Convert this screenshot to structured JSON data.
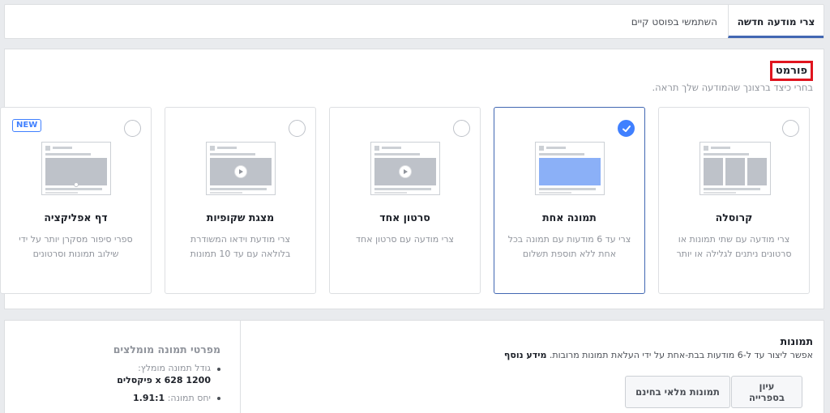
{
  "tabs": [
    {
      "label": "צרי מודעה חדשה",
      "active": true
    },
    {
      "label": "השתמשי בפוסט קיים",
      "active": false
    }
  ],
  "format": {
    "title": "פורמט",
    "description": "בחרי כיצד ברצונך שהמודעה שלך תראה.",
    "cards": [
      {
        "id": "carousel",
        "title": "קרוסלה",
        "description": "צרי מודעה עם שתי תמונות או סרטונים ניתנים לגלילה או יותר",
        "selected": false
      },
      {
        "id": "single-image",
        "title": "תמונה אחת",
        "description": "צרי עד 6 מודעות עם תמונה בכל אחת ללא תוספת תשלום",
        "selected": true
      },
      {
        "id": "single-video",
        "title": "סרטון אחד",
        "description": "צרי מודעה עם סרטון אחד",
        "selected": false
      },
      {
        "id": "slideshow",
        "title": "מצגת שקופיות",
        "description": "צרי מודעת וידאו המשודרת בלולאה עם עד 10 תמונות",
        "selected": false
      },
      {
        "id": "canvas",
        "title": "דף אפליקציה",
        "description": "ספרי סיפור מסקרן יותר על ידי שילוב תמונות וסרטונים",
        "selected": false,
        "badge": "NEW"
      }
    ]
  },
  "images": {
    "title": "תמונות",
    "description": "אפשר ליצור עד ל-6 מודעות בבת-אחת על ידי העלאת תמונות מרובות.",
    "learn_more": "מידע נוסף",
    "library_button": "עיון בספרייה",
    "stock_button": "תמונות מלאי בחינם"
  },
  "specs": {
    "title": "מפרטי תמונה מומלצים",
    "size_label": "גודל תמונה מומלץ:",
    "size_value": "1200 x 628 פיקסלים",
    "ratio_label": "יחס תמונה:",
    "ratio_value": "1.91:1"
  },
  "colors": {
    "accent": "#4267b2",
    "selected_check": "#4080ff",
    "highlight_box": "#e0141e"
  }
}
